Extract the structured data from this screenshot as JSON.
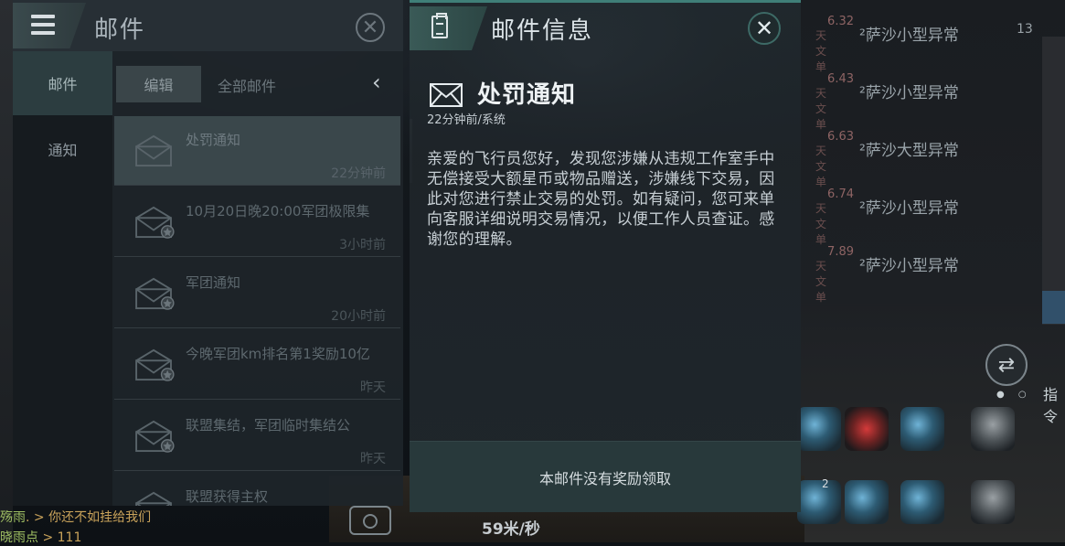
{
  "mail_panel": {
    "title": "邮件",
    "side_tabs": [
      {
        "label": "邮件",
        "active": true
      },
      {
        "label": "通知",
        "active": false
      }
    ],
    "edit_label": "编辑",
    "all_mail_label": "全部邮件",
    "collapse_glyph": "‹",
    "close_glyph": "✕",
    "items": [
      {
        "title": "处罚通知",
        "time": "22分钟前",
        "selected": true,
        "reward": false
      },
      {
        "title": "10月20日晚20:00军团极限集",
        "time": "3小时前",
        "selected": false,
        "reward": true
      },
      {
        "title": "军团通知",
        "time": "20小时前",
        "selected": false,
        "reward": true
      },
      {
        "title": "今晚军团km排名第1奖励10亿",
        "time": "昨天",
        "selected": false,
        "reward": true
      },
      {
        "title": "联盟集结，军团临时集结公",
        "time": "昨天",
        "selected": false,
        "reward": true
      },
      {
        "title": "联盟获得主权",
        "time": "",
        "selected": false,
        "reward": false
      }
    ]
  },
  "info_panel": {
    "title": "邮件信息",
    "close_glyph": "✕",
    "subject": "处罚通知",
    "meta": "22分钟前/系统",
    "body": "亲爱的飞行员您好，发现您涉嫌从违规工作室手中无偿接受大额星币或物品赠送，涉嫌线下交易，因此对您进行禁止交易的处罚。如有疑问，您可来单向客服详细说明交易情况，以便工作人员查证。感谢您的理解。",
    "footer": "本邮件没有奖励领取"
  },
  "background": {
    "right_list": [
      {
        "value": "6.32",
        "unit": "天文单",
        "name": "²萨沙小型异常"
      },
      {
        "value": "6.43",
        "unit": "天文单",
        "name": "²萨沙小型异常"
      },
      {
        "value": "6.63",
        "unit": "天文单",
        "name": "²萨沙大型异常"
      },
      {
        "value": "6.74",
        "unit": "天文单",
        "name": "²萨沙小型异常"
      },
      {
        "value": "7.89",
        "unit": "天文单",
        "name": "²萨沙小型异常"
      }
    ],
    "top_right_badge": "13",
    "command_label": "指令",
    "module_badge": "2",
    "speed": "59米/秒",
    "chat": [
      {
        "who": "殇雨",
        "text": ". > 你还不如挂给我们"
      },
      {
        "who": "晓雨点",
        "text": " > 111"
      }
    ],
    "colors": {
      "accent": "#3f7f78",
      "panel": "#1e2429"
    }
  }
}
